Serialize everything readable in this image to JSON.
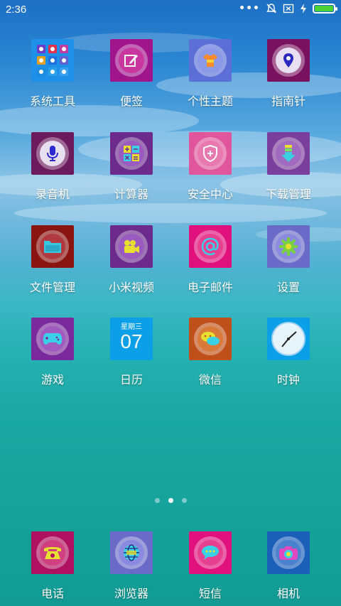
{
  "status_bar": {
    "time": "2:36",
    "icons": [
      "more-dots-icon",
      "notification-off-icon",
      "screenshot-icon",
      "charging-icon",
      "battery-icon"
    ],
    "battery_level": 1.0
  },
  "apps": [
    {
      "id": "system-tools",
      "label": "系统工具",
      "color": "#1e90e8",
      "icon": "folder-grid-icon"
    },
    {
      "id": "notes",
      "label": "便签",
      "color": "#a0148c",
      "icon": "note-edit-icon"
    },
    {
      "id": "themes",
      "label": "个性主题",
      "color": "#5b6fd6",
      "icon": "shirt-icon"
    },
    {
      "id": "compass",
      "label": "指南针",
      "color": "#7a1060",
      "icon": "location-pin-icon"
    },
    {
      "id": "recorder",
      "label": "录音机",
      "color": "#6b1a5c",
      "icon": "microphone-icon"
    },
    {
      "id": "calculator",
      "label": "计算器",
      "color": "#6b2a8c",
      "icon": "calculator-icon"
    },
    {
      "id": "security",
      "label": "安全中心",
      "color": "#e0569c",
      "icon": "shield-plus-icon"
    },
    {
      "id": "downloads",
      "label": "下载管理",
      "color": "#7a3e9c",
      "icon": "download-arrow-icon"
    },
    {
      "id": "files",
      "label": "文件管理",
      "color": "#8a1410",
      "icon": "folder-icon"
    },
    {
      "id": "video",
      "label": "小米视频",
      "color": "#6b2a8c",
      "icon": "video-camera-icon"
    },
    {
      "id": "email",
      "label": "电子邮件",
      "color": "#e0107c",
      "icon": "at-sign-icon"
    },
    {
      "id": "settings",
      "label": "设置",
      "color": "#6a6ac8",
      "icon": "gear-icon"
    },
    {
      "id": "games",
      "label": "游戏",
      "color": "#7a2a9c",
      "icon": "gamepad-icon"
    },
    {
      "id": "calendar",
      "label": "日历",
      "color": "#0b9fe8",
      "icon": "calendar-icon",
      "weekday": "星期三",
      "day": "07"
    },
    {
      "id": "wechat",
      "label": "微信",
      "color": "#c0501a",
      "icon": "chat-bubbles-icon"
    },
    {
      "id": "clock",
      "label": "时钟",
      "color": "#0b9fe8",
      "icon": "clock-icon"
    }
  ],
  "pager": {
    "pages": 3,
    "active": 2
  },
  "dock": [
    {
      "id": "phone",
      "label": "电话",
      "color": "#b01060",
      "icon": "telephone-icon"
    },
    {
      "id": "browser",
      "label": "浏览器",
      "color": "#6a6ac8",
      "icon": "globe-icon"
    },
    {
      "id": "sms",
      "label": "短信",
      "color": "#e0107c",
      "icon": "message-bubble-icon"
    },
    {
      "id": "camera",
      "label": "相机",
      "color": "#1a5fb8",
      "icon": "camera-icon"
    }
  ]
}
